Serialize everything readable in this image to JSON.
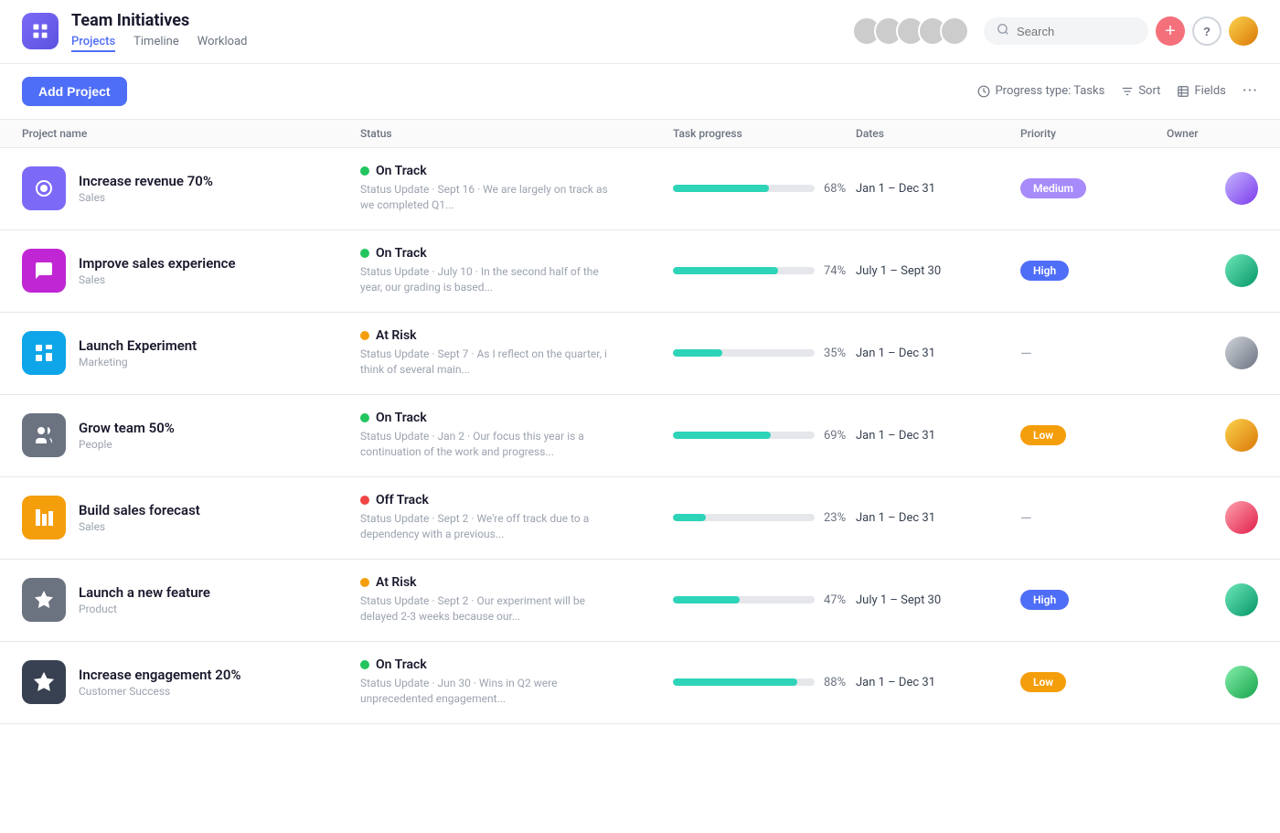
{
  "app": {
    "logo_icon": "chart-icon",
    "title": "Team Initiatives",
    "nav": [
      {
        "label": "Projects",
        "active": true
      },
      {
        "label": "Timeline",
        "active": false
      },
      {
        "label": "Workload",
        "active": false
      }
    ]
  },
  "toolbar": {
    "add_project_label": "Add Project",
    "progress_type_label": "Progress type: Tasks",
    "sort_label": "Sort",
    "fields_label": "Fields"
  },
  "table": {
    "columns": [
      "Project name",
      "Status",
      "Task progress",
      "Dates",
      "Priority",
      "Owner"
    ]
  },
  "projects": [
    {
      "name": "Increase revenue 70%",
      "team": "Sales",
      "icon_color": "#7c6af7",
      "status": "On Track",
      "status_color": "#22c55e",
      "status_update": "Status Update · Sept 16 · We are largely on track as we completed Q1...",
      "progress": 68,
      "dates": "Jan 1 – Dec 31",
      "priority": "Medium",
      "priority_class": "priority-medium",
      "owner_class": "av-purple"
    },
    {
      "name": "Improve sales experience",
      "team": "Sales",
      "icon_color": "#c026d3",
      "status": "On Track",
      "status_color": "#22c55e",
      "status_update": "Status Update · July 10 · In the second half of the year, our grading is based...",
      "progress": 74,
      "dates": "July 1 – Sept 30",
      "priority": "High",
      "priority_class": "priority-high",
      "owner_class": "av-teal"
    },
    {
      "name": "Launch Experiment",
      "team": "Marketing",
      "icon_color": "#0ea5e9",
      "status": "At Risk",
      "status_color": "#f59e0b",
      "status_update": "Status Update · Sept 7 · As I reflect on the quarter, i think of several main...",
      "progress": 35,
      "dates": "Jan 1 – Dec 31",
      "priority": null,
      "priority_class": "",
      "owner_class": "av-gray"
    },
    {
      "name": "Grow team 50%",
      "team": "People",
      "icon_color": "#6b7280",
      "status": "On Track",
      "status_color": "#22c55e",
      "status_update": "Status Update · Jan 2 · Our focus this year is a continuation of the work and progress...",
      "progress": 69,
      "dates": "Jan 1 – Dec 31",
      "priority": "Low",
      "priority_class": "priority-low",
      "owner_class": "av-orange"
    },
    {
      "name": "Build sales forecast",
      "team": "Sales",
      "icon_color": "#f59e0b",
      "status": "Off Track",
      "status_color": "#ef4444",
      "status_update": "Status Update · Sept 2 · We're off track due to a dependency with a previous...",
      "progress": 23,
      "dates": "Jan 1 – Dec 31",
      "priority": null,
      "priority_class": "",
      "owner_class": "av-pink"
    },
    {
      "name": "Launch a new feature",
      "team": "Product",
      "icon_color": "#6b7280",
      "status": "At Risk",
      "status_color": "#f59e0b",
      "status_update": "Status Update · Sept 2 · Our experiment will be delayed 2-3 weeks because our...",
      "progress": 47,
      "dates": "July 1 – Sept 30",
      "priority": "High",
      "priority_class": "priority-high",
      "owner_class": "av-teal"
    },
    {
      "name": "Increase engagement 20%",
      "team": "Customer Success",
      "icon_color": "#374151",
      "status": "On Track",
      "status_color": "#22c55e",
      "status_update": "Status Update · Jun 30 · Wins in Q2 were unprecedented engagement...",
      "progress": 88,
      "dates": "Jan 1 – Dec 31",
      "priority": "Low",
      "priority_class": "priority-low",
      "owner_class": "av-green"
    }
  ]
}
